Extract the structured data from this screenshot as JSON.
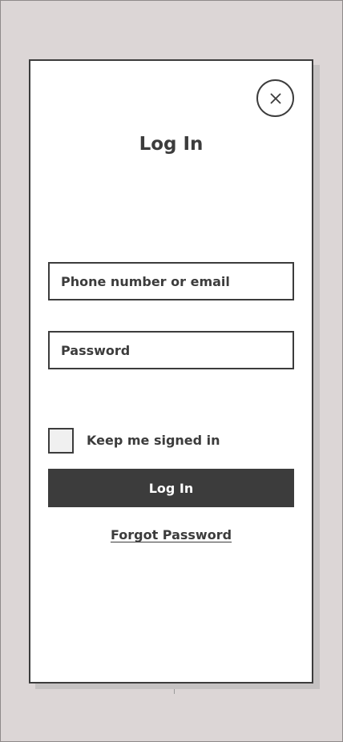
{
  "modal": {
    "title": "Log In",
    "close_icon": "close-icon",
    "phone_field": {
      "placeholder": "Phone number or email",
      "value": ""
    },
    "password_field": {
      "placeholder": "Password",
      "value": ""
    },
    "keep_signed_in": {
      "label": "Keep me signed in",
      "checked": false
    },
    "login_button_label": "Log In",
    "forgot_password_label": "Forgot Password"
  },
  "colors": {
    "background": "#dcd6d6",
    "modal_background": "#ffffff",
    "border": "#3c3c3c",
    "primary_button": "#3c3c3c",
    "shadow": "#c5c2c2",
    "checkbox_fill": "#f0f0f0"
  }
}
